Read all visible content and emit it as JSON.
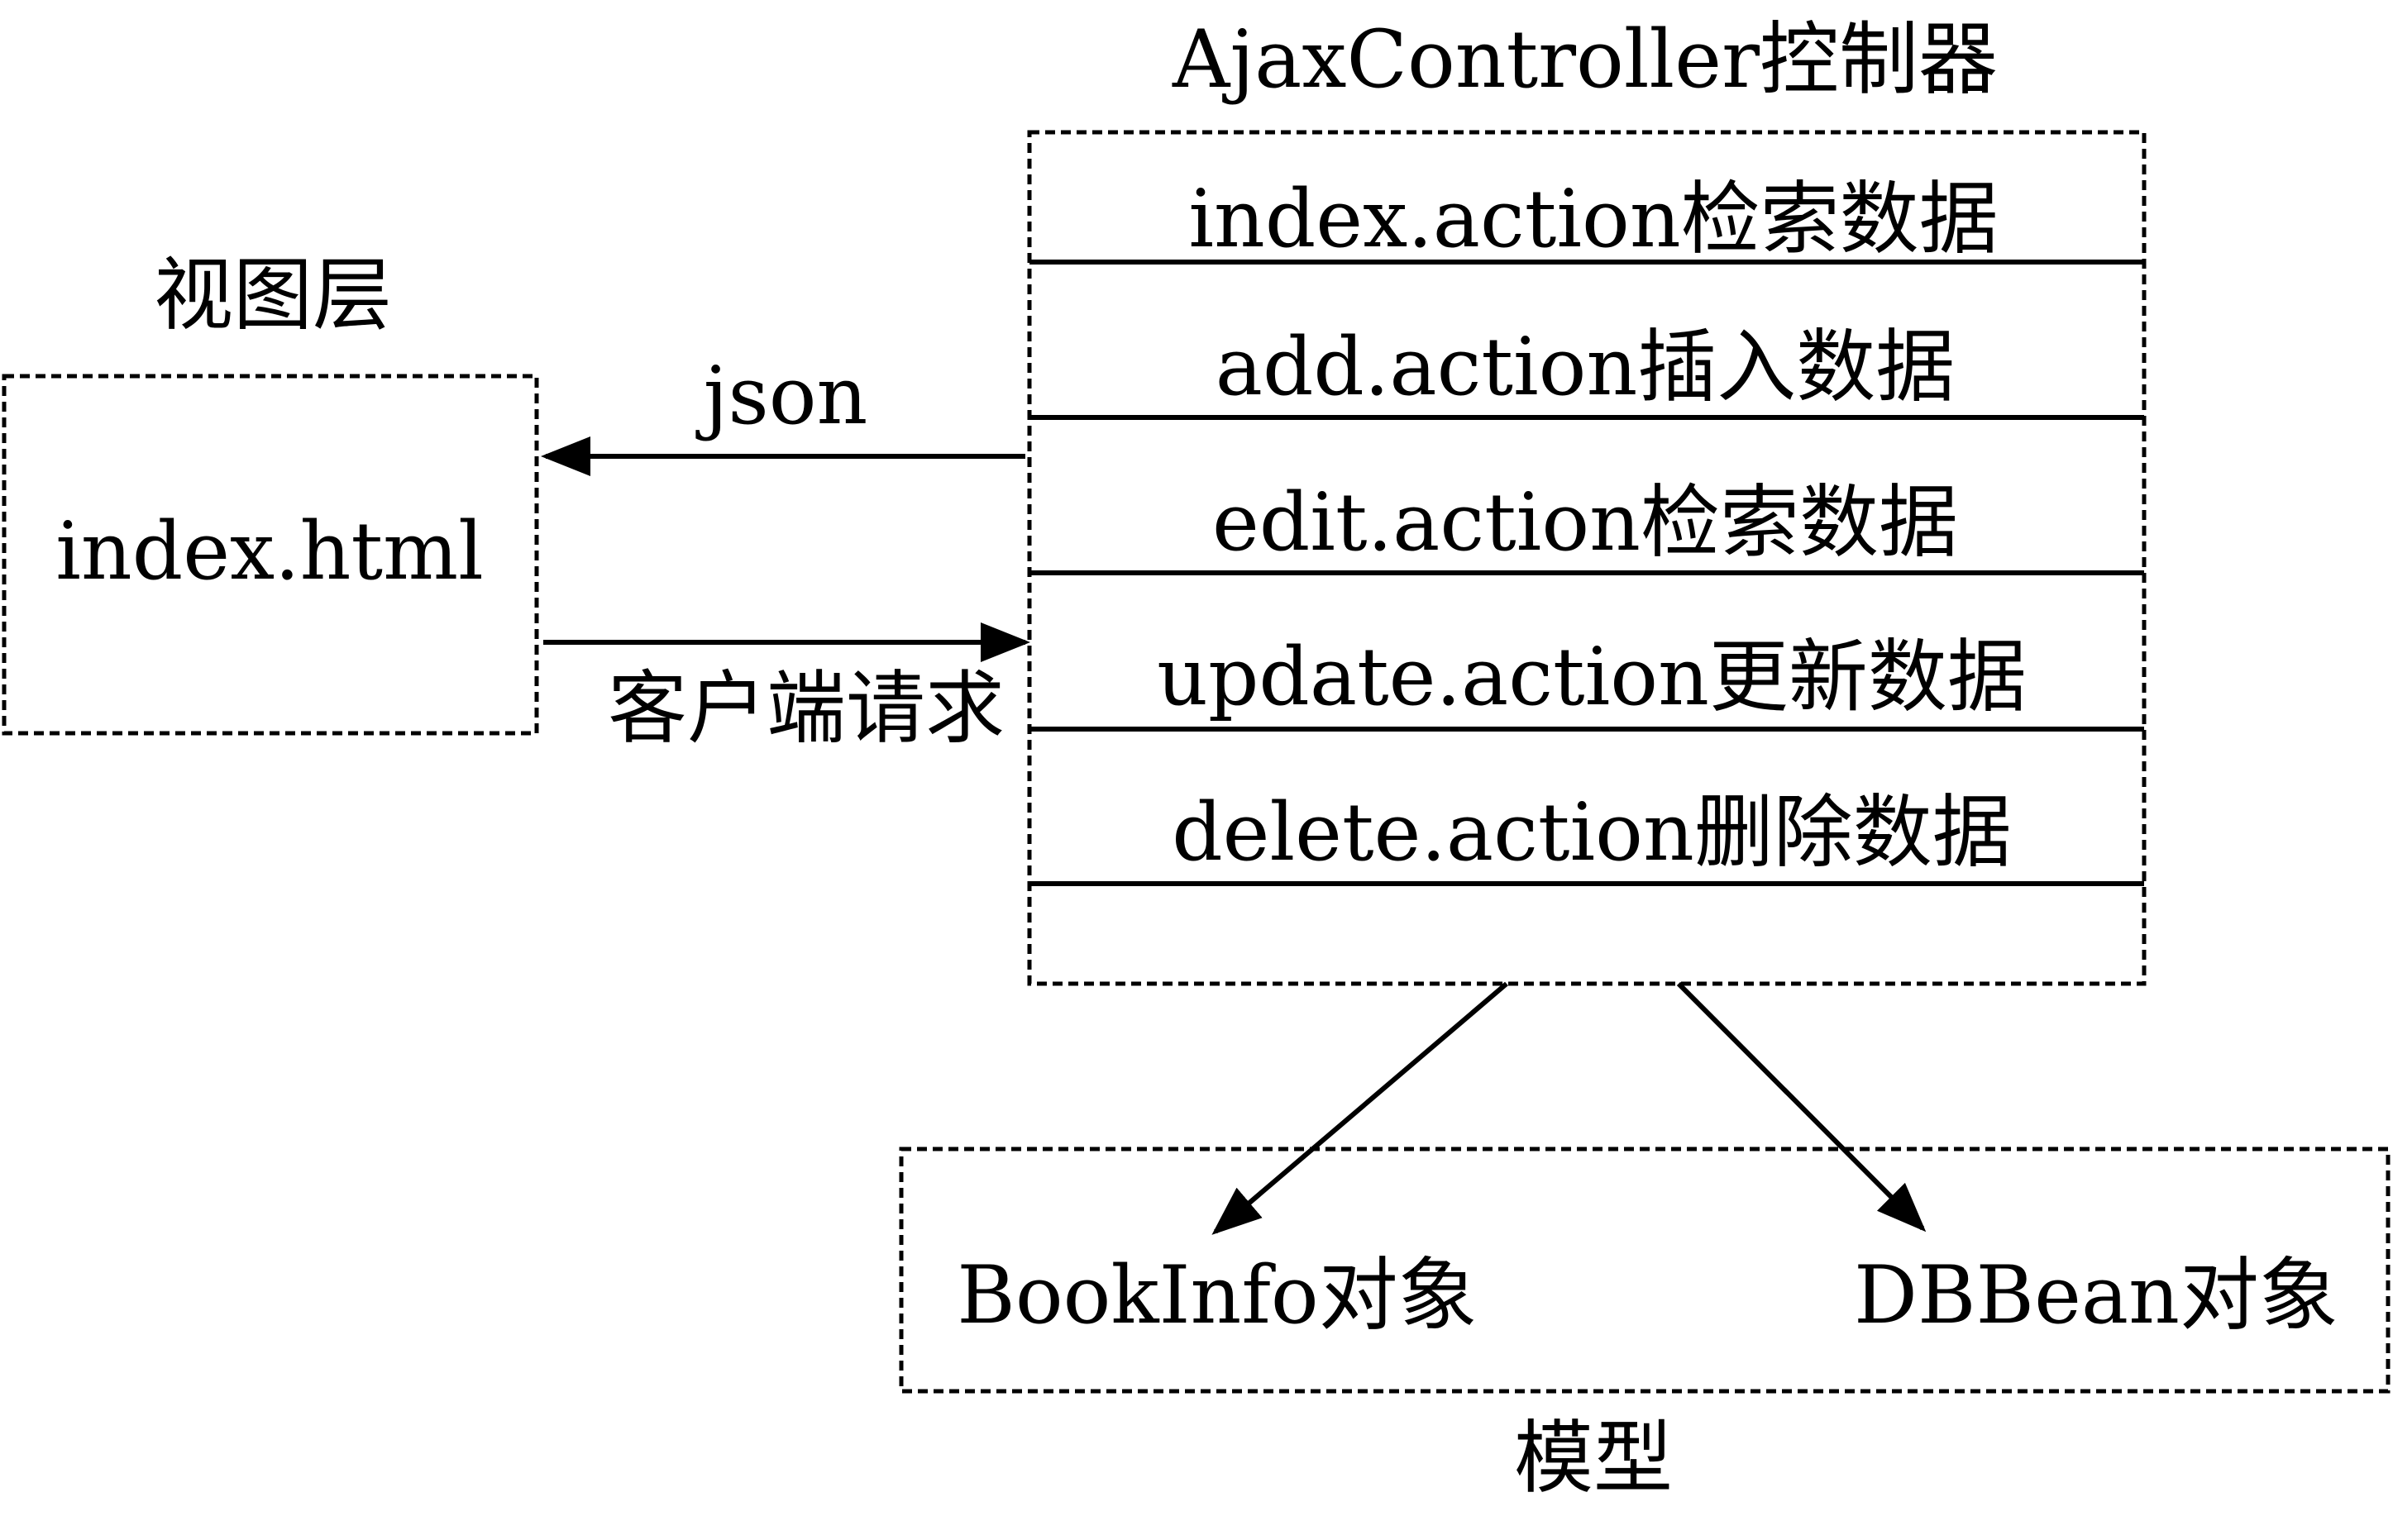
{
  "view": {
    "heading": "视图层",
    "page": "index.html"
  },
  "controller": {
    "heading": "AjaxController控制器",
    "actions": [
      "index.action检索数据",
      "add.action插入数据",
      "edit.action检索数据",
      "update.action更新数据",
      "delete.action删除数据"
    ]
  },
  "links": {
    "response": "json",
    "request": "客户端请求"
  },
  "model": {
    "heading": "模型",
    "objects": [
      "BookInfo对象",
      "DBBean对象"
    ]
  }
}
